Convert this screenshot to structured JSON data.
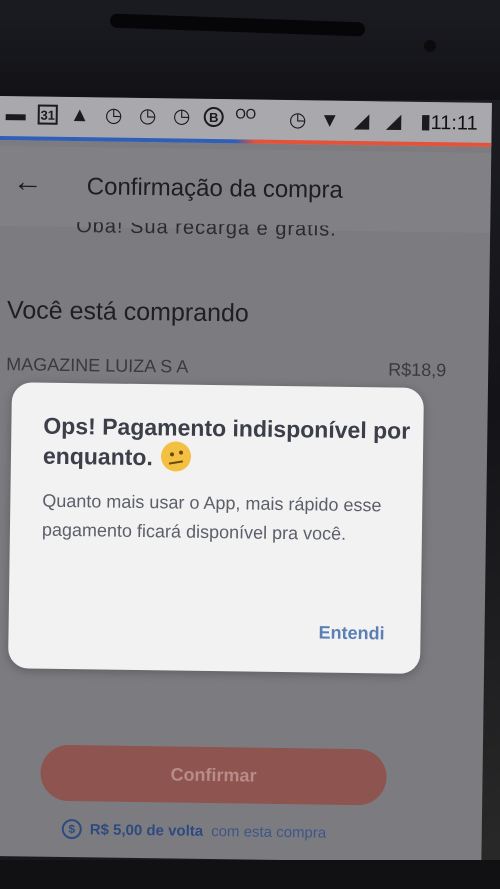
{
  "status_bar": {
    "time": "11:11",
    "icons": [
      "messages-icon",
      "calendar-icon",
      "alert-icon",
      "alarm-icon",
      "alarm-icon",
      "alarm-icon",
      "b-circle-icon",
      "voicemail-icon",
      "alarm-icon",
      "wifi-icon",
      "signal-icon",
      "signal-icon",
      "battery-icon"
    ],
    "calendar_day": "31",
    "b_label": "B"
  },
  "app_bar": {
    "back_icon": "arrow-left-icon",
    "title": "Confirmação da compra"
  },
  "content": {
    "cut_text": "Oba! Sua recarga é grátis.",
    "section_title": "Você está comprando",
    "merchant_name": "MAGAZINE LUIZA S A",
    "merchant_price": "R$18,9"
  },
  "dialog": {
    "title": "Ops! Pagamento indisponível por enquanto.",
    "emoji": "thinking-face-emoji",
    "body": "Quanto mais usar o App, mais rápido esse pagamento ficará disponível pra você.",
    "action": "Entendi"
  },
  "footer": {
    "confirm_label": "Confirmar",
    "cashback_icon": "cashback-coin-icon",
    "cashback_amount": "R$ 5,00 de volta",
    "cashback_rest": "com esta compra"
  },
  "nav": {
    "back": "nav-back-icon",
    "home": "nav-home-icon",
    "recent": "nav-recent-icon"
  },
  "colors": {
    "dialog_bg": "#f2f2f2",
    "title_text": "#3c3f4a",
    "action_text": "#5b7fb5",
    "confirm_bg": "#8e5450",
    "cashback_text": "#2d4a80"
  }
}
